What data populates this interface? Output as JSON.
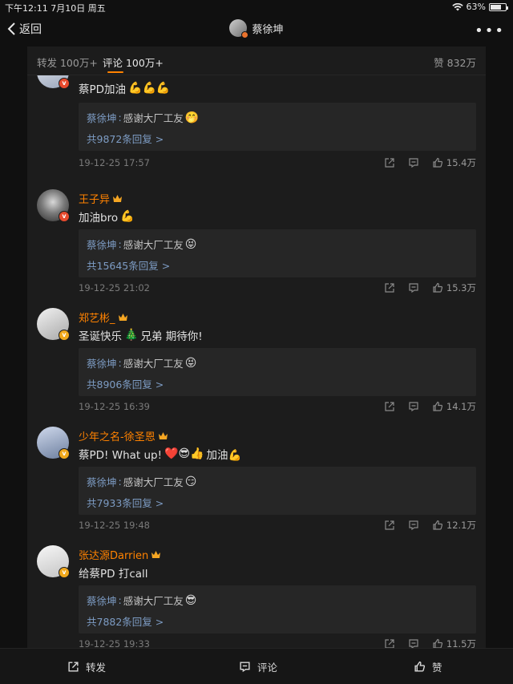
{
  "status_bar": {
    "time": "下午12:11",
    "date": "7月10日 周五",
    "battery": "63%",
    "battery_level": 0.63
  },
  "nav": {
    "back_label": "返回",
    "title": "蔡徐坤",
    "more_icon": "more-dots-icon"
  },
  "tabs": {
    "repost": "转发 100万+",
    "comments": "评论 100万+",
    "likes": "赞 832万"
  },
  "colors": {
    "accent": "#ff8200",
    "link": "#7d9cc4",
    "background": "#1c1c1c"
  },
  "comments": [
    {
      "username": "",
      "text": "蔡PD加油",
      "emojis": "💪💪💪",
      "reply_author": "蔡徐坤",
      "reply_text": "感谢大厂工友",
      "reply_emoji": "🤭",
      "reply_count": "共9872条回复 >",
      "time": "19-12-25 17:57",
      "likes": "15.4万"
    },
    {
      "username": "王子异",
      "text": "加油bro",
      "emojis": "💪",
      "reply_author": "蔡徐坤",
      "reply_text": "感谢大厂工友",
      "reply_emoji": "😝",
      "reply_count": "共15645条回复 >",
      "time": "19-12-25 21:02",
      "likes": "15.3万"
    },
    {
      "username": "郑艺彬_",
      "text": "圣诞快乐",
      "emojis": "🎄",
      "text2": "兄弟 期待你!",
      "reply_author": "蔡徐坤",
      "reply_text": "感谢大厂工友",
      "reply_emoji": "😝",
      "reply_count": "共8906条回复 >",
      "time": "19-12-25 16:39",
      "likes": "14.1万"
    },
    {
      "username": "少年之名-徐圣恩",
      "text": "蔡PD! What up!",
      "emojis": "❤️😎👍",
      "text2": "加油💪",
      "reply_author": "蔡徐坤",
      "reply_text": "感谢大厂工友",
      "reply_emoji": "😏",
      "reply_count": "共7933条回复 >",
      "time": "19-12-25 19:48",
      "likes": "12.1万"
    },
    {
      "username": "张达源Darrien",
      "text": "给蔡PD 打call",
      "emojis": "",
      "reply_author": "蔡徐坤",
      "reply_text": "感谢大厂工友",
      "reply_emoji": "😎",
      "reply_count": "共7882条回复 >",
      "time": "19-12-25 19:33",
      "likes": "11.5万"
    }
  ],
  "bottom_bar": {
    "repost": "转发",
    "comment": "评论",
    "like": "赞"
  }
}
